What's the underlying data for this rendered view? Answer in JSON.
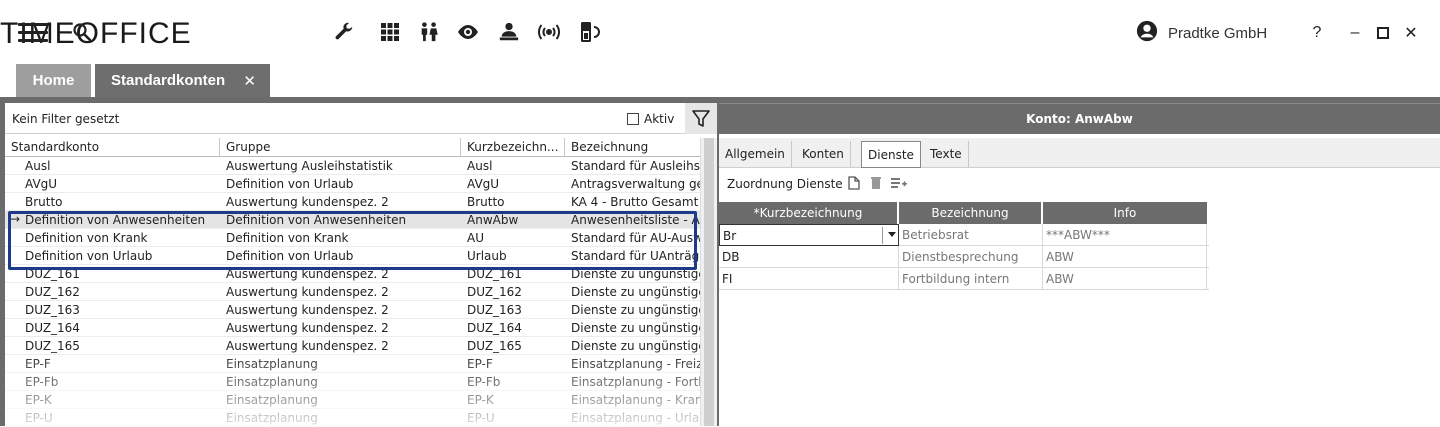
{
  "app": {
    "brand": "TIMEOFFICE",
    "company": "Pradtke GmbH",
    "window_controls": {
      "help": "?",
      "minimize": "–",
      "maximize": "☐",
      "close": "✕"
    },
    "toolbar_icons": [
      "wrench-icon",
      "grid-icon",
      "persons-icon",
      "eye-icon",
      "user-desk-icon",
      "signal-icon",
      "battery-phone-icon"
    ]
  },
  "tabs": [
    {
      "label": "Home"
    },
    {
      "label": "Standardkonten",
      "close": "✕"
    }
  ],
  "left": {
    "filter_text": "Kein Filter gesetzt",
    "aktiv_label": "Aktiv",
    "columns": [
      "Standardkonto",
      "Gruppe",
      "Kurzbezeichn...",
      "Bezeichnung"
    ],
    "rows": [
      {
        "konto": "Ausl",
        "gruppe": "Auswertung Ausleihstatistik",
        "kurz": "Ausl",
        "bez": "Standard für Ausleihstatistik"
      },
      {
        "konto": "AVgU",
        "gruppe": "Definition von Urlaub",
        "kurz": "AVgU",
        "bez": "Antragsverwaltung genehmigter Urlaub"
      },
      {
        "konto": "Brutto",
        "gruppe": "Auswertung kundenspez. 2",
        "kurz": "Brutto",
        "bez": "KA 4 - Brutto Gesamt"
      },
      {
        "konto": "Definition von Anwesenheiten",
        "gruppe": "Definition von Anwesenheiten",
        "kurz": "AnwAbw",
        "bez": "Anwesenheitsliste - Abwesenheiten",
        "selected": true
      },
      {
        "konto": "Definition von Krank",
        "gruppe": "Definition von Krank",
        "kurz": "AU",
        "bez": "Standard für AU-Auswertung"
      },
      {
        "konto": "Definition von Urlaub",
        "gruppe": "Definition von Urlaub",
        "kurz": "Urlaub",
        "bez": "Standard für UAnträge"
      },
      {
        "konto": "DUZ_161",
        "gruppe": "Auswertung kundenspez. 2",
        "kurz": "DUZ_161",
        "bez": "Dienste zu ungünstigen Zeiten"
      },
      {
        "konto": "DUZ_162",
        "gruppe": "Auswertung kundenspez. 2",
        "kurz": "DUZ_162",
        "bez": "Dienste zu ungünstigen Zeiten"
      },
      {
        "konto": "DUZ_163",
        "gruppe": "Auswertung kundenspez. 2",
        "kurz": "DUZ_163",
        "bez": "Dienste zu ungünstigen Zeiten"
      },
      {
        "konto": "DUZ_164",
        "gruppe": "Auswertung kundenspez. 2",
        "kurz": "DUZ_164",
        "bez": "Dienste zu ungünstigen Zeiten"
      },
      {
        "konto": "DUZ_165",
        "gruppe": "Auswertung kundenspez. 2",
        "kurz": "DUZ_165",
        "bez": "Dienste zu ungünstigen Zeiten"
      },
      {
        "konto": "EP-F",
        "gruppe": "Einsatzplanung",
        "kurz": "EP-F",
        "bez": "Einsatzplanung - Freizeit"
      },
      {
        "konto": "EP-Fb",
        "gruppe": "Einsatzplanung",
        "kurz": "EP-Fb",
        "bez": "Einsatzplanung - Fortbildung"
      },
      {
        "konto": "EP-K",
        "gruppe": "Einsatzplanung",
        "kurz": "EP-K",
        "bez": "Einsatzplanung - Krank"
      },
      {
        "konto": "EP-U",
        "gruppe": "Einsatzplanung",
        "kurz": "EP-U",
        "bez": "Einsatzplanung - Urlaub"
      }
    ]
  },
  "right": {
    "title": "Konto: AnwAbw",
    "tabs": [
      "Allgemein",
      "Konten",
      "Dienste",
      "Texte"
    ],
    "active_tab": "Dienste",
    "section_label": "Zuordnung Dienste",
    "columns": [
      "*Kurzbezeichnung",
      "Bezeichnung",
      "Info"
    ],
    "rows": [
      {
        "kurz": "Br",
        "bez": "Betriebsrat",
        "info": "***ABW***",
        "editing": true
      },
      {
        "kurz": "DB",
        "bez": "Dienstbesprechung",
        "info": "ABW"
      },
      {
        "kurz": "FI",
        "bez": "Fortbildung intern",
        "info": "ABW"
      }
    ]
  }
}
